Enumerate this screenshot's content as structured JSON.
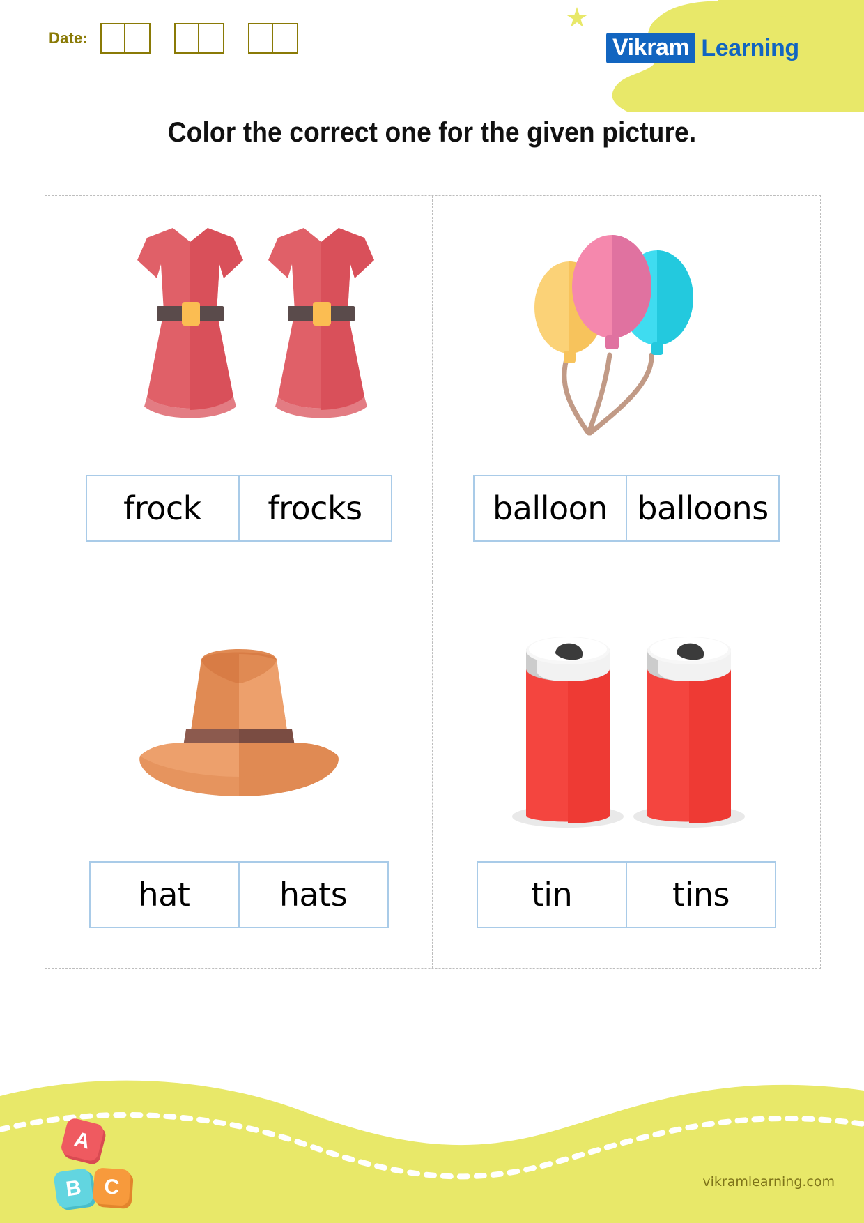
{
  "header": {
    "date_label": "Date:",
    "date_groups": 3,
    "date_cells_per_group": 2,
    "date_color": "#8a7a06",
    "logo": {
      "badge_text": "Vikram",
      "word_text": "Learning",
      "badge_bg": "#1265c0",
      "badge_fg": "#ffffff",
      "word_color": "#1265c0",
      "blob_color": "#e8e869",
      "star_icon": "star-icon"
    }
  },
  "title": "Color the correct one for the given picture.",
  "grid": {
    "border_color": "#bdbdbd",
    "wordbox_border": "#a9cbe8",
    "cells": [
      {
        "id": "frock",
        "picture": "dress-illustration",
        "picture_count": 2,
        "options": [
          "frock",
          "frocks"
        ]
      },
      {
        "id": "balloon",
        "picture": "balloons-illustration",
        "picture_count": 3,
        "options": [
          "balloon",
          "balloons"
        ]
      },
      {
        "id": "hat",
        "picture": "hat-illustration",
        "picture_count": 1,
        "options": [
          "hat",
          "hats"
        ]
      },
      {
        "id": "tin",
        "picture": "tin-cans-illustration",
        "picture_count": 2,
        "options": [
          "tin",
          "tins"
        ]
      }
    ]
  },
  "footer": {
    "url": "vikramlearning.com",
    "wave_color": "#e8e869",
    "url_color": "#7d7319",
    "blocks": [
      {
        "letter": "A",
        "color": "#ef5a60"
      },
      {
        "letter": "B",
        "color": "#62d5e0"
      },
      {
        "letter": "C",
        "color": "#f79a3c"
      }
    ]
  },
  "colors": {
    "dress_main": "#d9505a",
    "dress_light": "#e06068",
    "dress_belt": "#5a4b4b",
    "dress_buckle": "#fbbd52",
    "balloon_yellow": "#fbd277",
    "balloon_pink": "#f588ad",
    "balloon_cyan": "#3fdcf0",
    "balloon_string": "#c19a86",
    "hat_main": "#e08a53",
    "hat_light": "#eda06c",
    "hat_band": "#8c5a4e",
    "can_red": "#f4453f",
    "can_top": "#f2f2f2",
    "can_grey": "#c9c9c9",
    "can_hole": "#3b3b3b"
  }
}
